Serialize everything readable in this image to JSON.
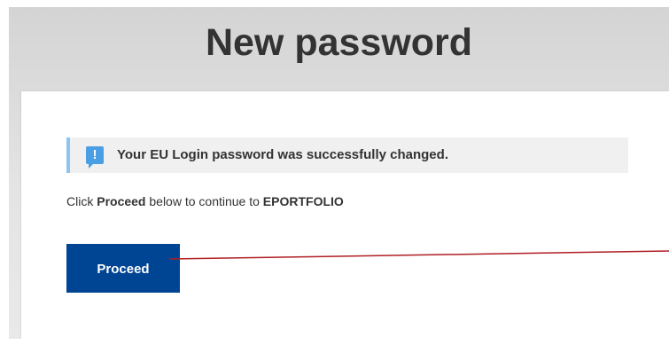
{
  "page": {
    "title": "New password"
  },
  "alert": {
    "icon": "info-speech-icon",
    "icon_glyph": "!",
    "message": "Your EU Login password was successfully changed."
  },
  "instruction": {
    "prefix": "Click ",
    "action": "Proceed",
    "middle": " below to continue to ",
    "target": "EPORTFOLIO"
  },
  "buttons": {
    "proceed_label": "Proceed"
  },
  "colors": {
    "primary_button": "#004494",
    "alert_icon": "#4a9ee3",
    "alert_border": "#8ec5f0",
    "annotation_line": "#b01e23"
  }
}
